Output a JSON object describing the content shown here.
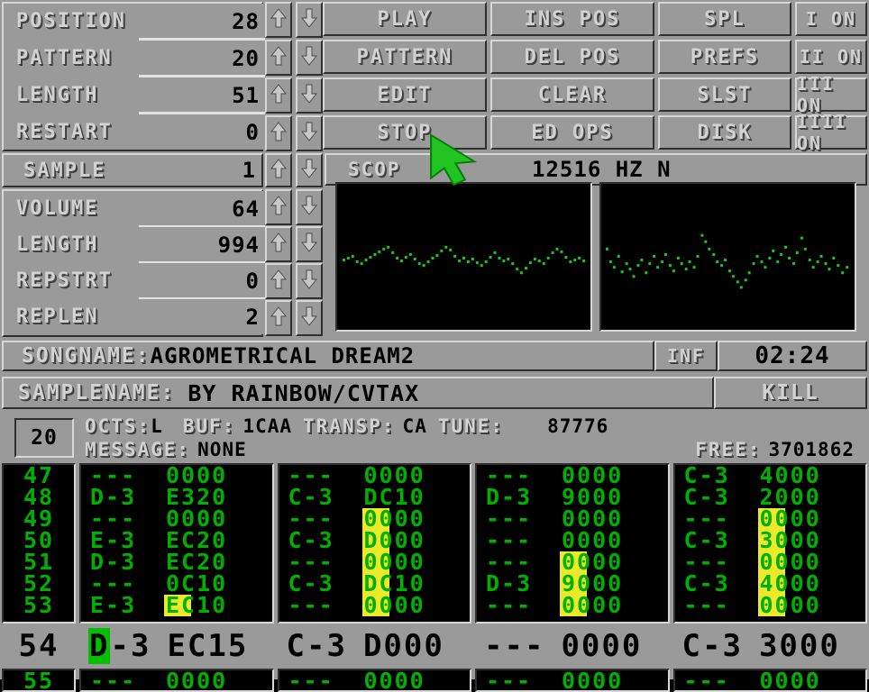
{
  "app": {
    "title": "ProTracker",
    "bg_color": "#9a9a9a",
    "accent_green": "#00b000",
    "cursor_green": "#00c000",
    "volbar_yellow": "#ece82a"
  },
  "params": [
    {
      "name": "POSITION",
      "value": "28"
    },
    {
      "name": "PATTERN",
      "value": "20"
    },
    {
      "name": "LENGTH",
      "value": "51"
    },
    {
      "name": "RESTART",
      "value": "0"
    }
  ],
  "sample_row": {
    "name": "SAMPLE",
    "value": "1"
  },
  "sample_params": [
    {
      "name": "VOLUME",
      "value": "64"
    },
    {
      "name": "LENGTH",
      "value": "994"
    },
    {
      "name": "REPSTRT",
      "value": "0"
    },
    {
      "name": "REPLEN",
      "value": "2"
    }
  ],
  "buttons": {
    "col1": [
      "PLAY",
      "PATTERN",
      "EDIT",
      "STOP"
    ],
    "col2": [
      "INS POS",
      "DEL POS",
      "CLEAR",
      "ED OPS"
    ],
    "col3": [
      "SPL",
      "PREFS",
      "SLST",
      "DISK"
    ],
    "col4": [
      "I ON",
      "II ON",
      "III ON",
      "IIII ON"
    ]
  },
  "scope_header": {
    "label": "SCOP",
    "freq": "12516 HZ  N"
  },
  "song": {
    "songname_label": "SONGNAME:",
    "songname_value": "AGROMETRICAL DREAM2",
    "inf_label": "INF",
    "time": "02:24",
    "samplename_label": "SAMPLENAME:",
    "samplename_value": "BY RAINBOW/CVTAX",
    "kill_label": "KILL"
  },
  "info": {
    "pattern_box": "20",
    "octs_label": "OCTS:",
    "octs_value": "L",
    "buf_label": "BUF:",
    "buf_value": "1CAA",
    "transp_label": "TRANSP:",
    "transp_value": "CA",
    "tune_label": "TUNE:",
    "tune_value": "87776",
    "message_label": "MESSAGE:",
    "message_value": "NONE",
    "free_label": "FREE:",
    "free_value": "3701862"
  },
  "pattern": {
    "row_numbers": [
      "47",
      "48",
      "49",
      "50",
      "51",
      "52",
      "53"
    ],
    "channels": [
      {
        "index": 1,
        "rows": [
          {
            "note": "---",
            "eff": "0000"
          },
          {
            "note": "D-3",
            "eff": "E320"
          },
          {
            "note": "---",
            "eff": "0000"
          },
          {
            "note": "E-3",
            "eff": "EC20"
          },
          {
            "note": "D-3",
            "eff": "EC20"
          },
          {
            "note": "---",
            "eff": "0C10"
          },
          {
            "note": "E-3",
            "eff": "EC10"
          }
        ],
        "volbar_start_row": 6,
        "volbar_rows": 1
      },
      {
        "index": 2,
        "rows": [
          {
            "note": "---",
            "eff": "0000"
          },
          {
            "note": "C-3",
            "eff": "DC10"
          },
          {
            "note": "---",
            "eff": "0000"
          },
          {
            "note": "C-3",
            "eff": "D000"
          },
          {
            "note": "---",
            "eff": "0000"
          },
          {
            "note": "C-3",
            "eff": "DC10"
          },
          {
            "note": "---",
            "eff": "0000"
          }
        ],
        "volbar_start_row": 2,
        "volbar_rows": 5
      },
      {
        "index": 3,
        "rows": [
          {
            "note": "---",
            "eff": "0000"
          },
          {
            "note": "D-3",
            "eff": "9000"
          },
          {
            "note": "---",
            "eff": "0000"
          },
          {
            "note": "---",
            "eff": "0000"
          },
          {
            "note": "---",
            "eff": "0000"
          },
          {
            "note": "D-3",
            "eff": "9000"
          },
          {
            "note": "---",
            "eff": "0000"
          }
        ],
        "volbar_start_row": 4,
        "volbar_rows": 3
      },
      {
        "index": 4,
        "rows": [
          {
            "note": "C-3",
            "eff": "4000"
          },
          {
            "note": "C-3",
            "eff": "2000"
          },
          {
            "note": "---",
            "eff": "0000"
          },
          {
            "note": "C-3",
            "eff": "3000"
          },
          {
            "note": "---",
            "eff": "0000"
          },
          {
            "note": "C-3",
            "eff": "4000"
          },
          {
            "note": "---",
            "eff": "0000"
          }
        ],
        "volbar_start_row": 2,
        "volbar_rows": 5
      }
    ],
    "current_row": {
      "number": "54",
      "channels": [
        {
          "note_first": "D",
          "note_rest": "-3",
          "eff": "EC15"
        },
        {
          "note_first": "C",
          "note_rest": "-3",
          "eff": "D000"
        },
        {
          "note_first": "-",
          "note_rest": "--",
          "eff": "0000"
        },
        {
          "note_first": "C",
          "note_rest": "-3",
          "eff": "3000"
        }
      ]
    },
    "next_row": {
      "number": "55",
      "channels": [
        {
          "note": "---",
          "eff": "0000"
        },
        {
          "note": "---",
          "eff": "0000"
        },
        {
          "note": "---",
          "eff": "0000"
        },
        {
          "note": "---",
          "eff": "0000"
        }
      ]
    }
  },
  "icons": {
    "arrow_up": "arrow-up-icon",
    "arrow_down": "arrow-down-icon",
    "mouse_pointer": "mouse-pointer-icon"
  }
}
